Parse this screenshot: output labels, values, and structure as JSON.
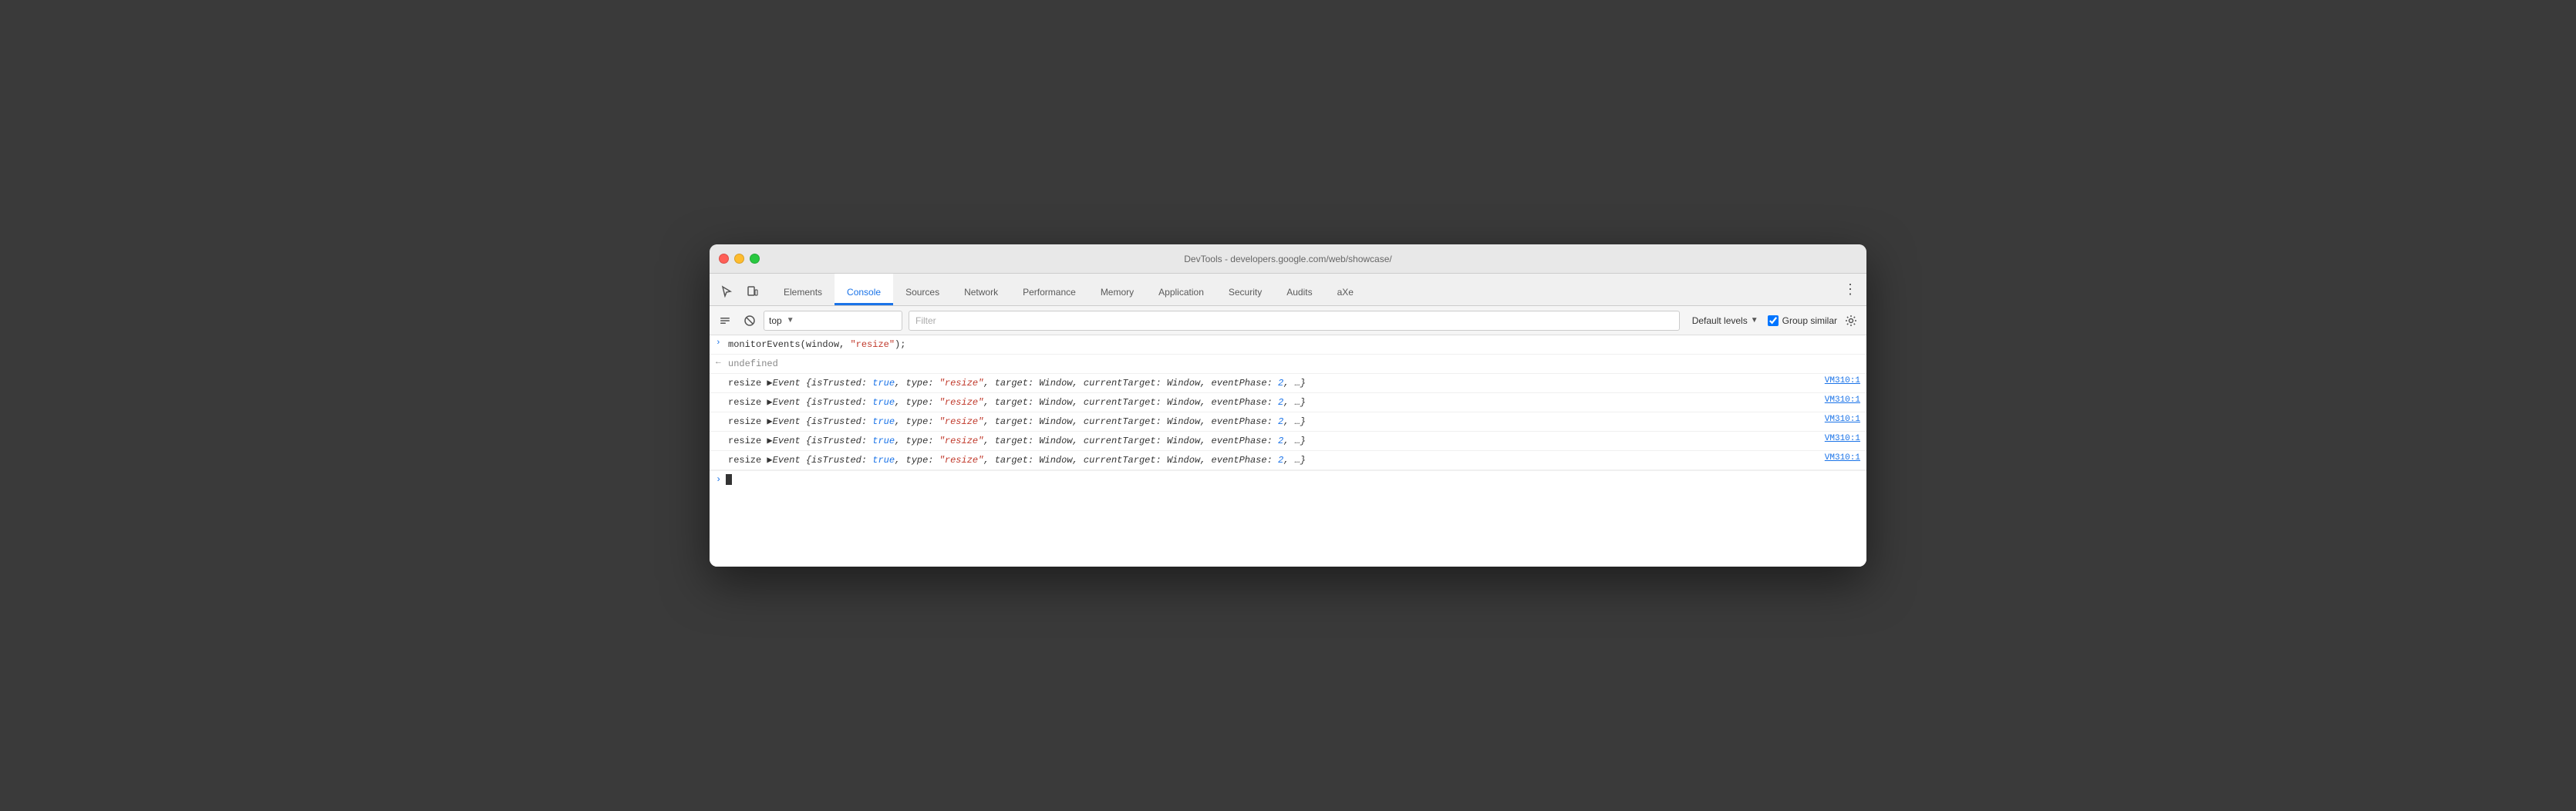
{
  "window": {
    "title": "DevTools - developers.google.com/web/showcase/"
  },
  "tabs": {
    "items": [
      {
        "label": "Elements",
        "active": false
      },
      {
        "label": "Console",
        "active": true
      },
      {
        "label": "Sources",
        "active": false
      },
      {
        "label": "Network",
        "active": false
      },
      {
        "label": "Performance",
        "active": false
      },
      {
        "label": "Memory",
        "active": false
      },
      {
        "label": "Application",
        "active": false
      },
      {
        "label": "Security",
        "active": false
      },
      {
        "label": "Audits",
        "active": false
      },
      {
        "label": "aXe",
        "active": false
      }
    ]
  },
  "toolbar": {
    "context_value": "top",
    "filter_placeholder": "Filter",
    "default_levels_label": "Default levels",
    "group_similar_label": "Group similar",
    "group_similar_checked": true
  },
  "console": {
    "rows": [
      {
        "type": "input",
        "chevron": "›",
        "content": "monitorEvents(window, \"resize\");"
      },
      {
        "type": "output",
        "chevron": "←",
        "content": "undefined"
      },
      {
        "type": "event",
        "prefix": "resize",
        "content": " ▶Event {isTrusted: true, type: \"resize\", target: Window, currentTarget: Window, eventPhase: 2, …}",
        "source": "VM310:1"
      },
      {
        "type": "event",
        "prefix": "resize",
        "content": " ▶Event {isTrusted: true, type: \"resize\", target: Window, currentTarget: Window, eventPhase: 2, …}",
        "source": "VM310:1"
      },
      {
        "type": "event",
        "prefix": "resize",
        "content": " ▶Event {isTrusted: true, type: \"resize\", target: Window, currentTarget: Window, eventPhase: 2, …}",
        "source": "VM310:1"
      },
      {
        "type": "event",
        "prefix": "resize",
        "content": " ▶Event {isTrusted: true, type: \"resize\", target: Window, currentTarget: Window, eventPhase: 2, …}",
        "source": "VM310:1"
      },
      {
        "type": "event",
        "prefix": "resize",
        "content": " ▶Event {isTrusted: true, type: \"resize\", target: Window, currentTarget: Window, eventPhase: 2, …}",
        "source": "VM310:1"
      }
    ],
    "input_prompt": "›"
  }
}
